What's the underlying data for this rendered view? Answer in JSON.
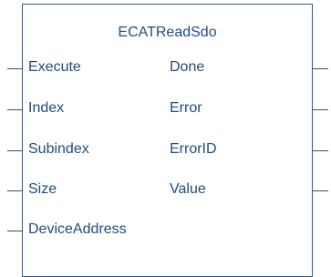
{
  "block": {
    "title": "ECATReadSdo",
    "inputs": [
      "Execute",
      "Index",
      "Subindex",
      "Size",
      "DeviceAddress"
    ],
    "outputs": [
      "Done",
      "Error",
      "ErrorID",
      "Value"
    ]
  }
}
